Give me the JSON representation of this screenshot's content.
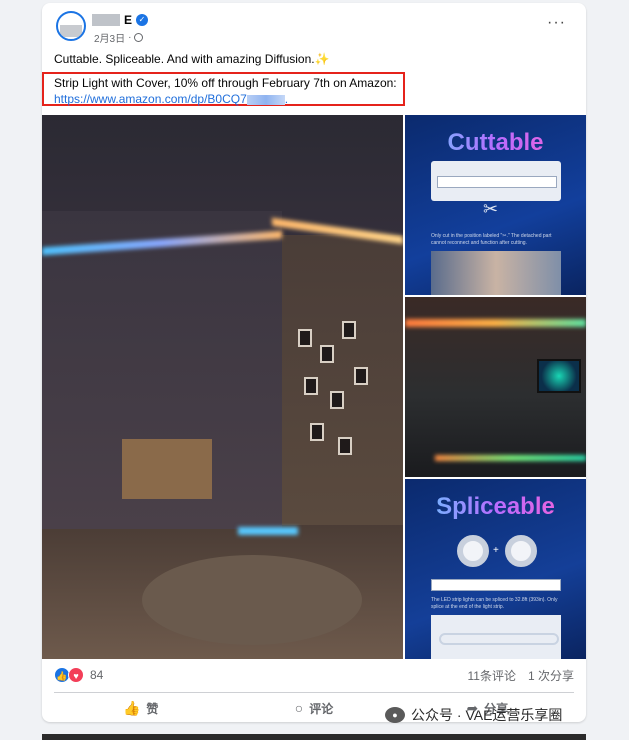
{
  "post": {
    "page_name": "E",
    "date": "2月3日",
    "caption": "Cuttable. Spliceable. And with amazing Diffusion.",
    "caption_emoji": "✨",
    "promo_line": "Strip Light with Cover, 10% off through February 7th on Amazon:",
    "promo_link": "https://www.amazon.com/dp/B0CQ7",
    "promo_link_suffix": ".",
    "more_label": "···"
  },
  "gallery": {
    "panel_1_title": "Cuttable",
    "panel_1_note": "Only cut in the position labeled \"✂.\" The detached part cannot reconnect and function after cutting.",
    "panel_3_title": "Spliceable",
    "panel_3_note": "The LED strip lights can be spliced to 32.8ft (393in). Only splice at the end of the light strip."
  },
  "engagement": {
    "reaction_count": "84",
    "comments": "11条评论",
    "shares": "1 次分享"
  },
  "actions": {
    "like": "赞",
    "comment": "评论",
    "share": "分享"
  },
  "watermark": {
    "text": "公众号 · VAE运营乐享圈"
  },
  "icons": {
    "like": "thumb-up-icon",
    "comment": "speech-bubble-icon",
    "share": "share-arrow-icon",
    "globe": "globe-icon",
    "verified": "verified-badge-icon"
  },
  "colors": {
    "accent": "#1b74e4",
    "highlight_box": "#e5231b",
    "link": "#216fdb"
  }
}
